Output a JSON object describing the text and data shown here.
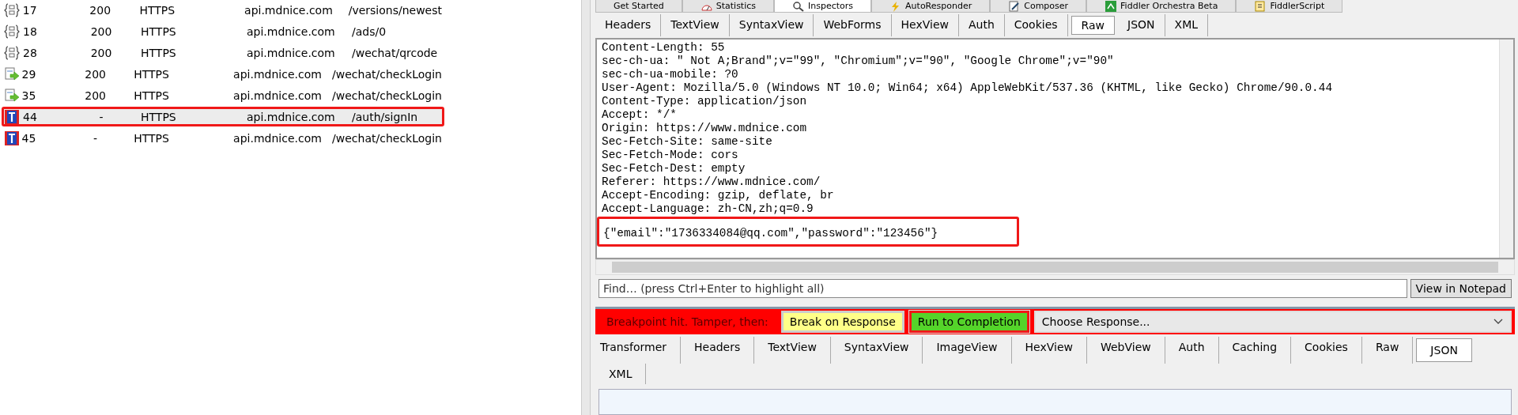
{
  "sessions": [
    {
      "id": "17",
      "result": "200",
      "protocol": "HTTPS",
      "host": "api.mdnice.com",
      "url": "/versions/newest",
      "kind": "json",
      "selected": false,
      "highlighted": false
    },
    {
      "id": "18",
      "result": "200",
      "protocol": "HTTPS",
      "host": "api.mdnice.com",
      "url": "/ads/0",
      "kind": "json",
      "selected": false,
      "highlighted": false
    },
    {
      "id": "28",
      "result": "200",
      "protocol": "HTTPS",
      "host": "api.mdnice.com",
      "url": "/wechat/qrcode",
      "kind": "json",
      "selected": false,
      "highlighted": false
    },
    {
      "id": "29",
      "result": "200",
      "protocol": "HTTPS",
      "host": "api.mdnice.com",
      "url": "/wechat/checkLogin",
      "kind": "response",
      "selected": false,
      "highlighted": false
    },
    {
      "id": "35",
      "result": "200",
      "protocol": "HTTPS",
      "host": "api.mdnice.com",
      "url": "/wechat/checkLogin",
      "kind": "response",
      "selected": false,
      "highlighted": false
    },
    {
      "id": "44",
      "result": "-",
      "protocol": "HTTPS",
      "host": "api.mdnice.com",
      "url": "/auth/signIn",
      "kind": "breakpoint",
      "selected": true,
      "highlighted": true
    },
    {
      "id": "45",
      "result": "-",
      "protocol": "HTTPS",
      "host": "api.mdnice.com",
      "url": "/wechat/checkLogin",
      "kind": "breakpoint",
      "selected": false,
      "highlighted": false
    }
  ],
  "top_tabs": [
    {
      "label": "Get Started",
      "selected": false
    },
    {
      "label": "Statistics",
      "selected": false
    },
    {
      "label": "Inspectors",
      "selected": true
    },
    {
      "label": "AutoResponder",
      "selected": false
    },
    {
      "label": "Composer",
      "selected": false
    },
    {
      "label": "Fiddler Orchestra Beta",
      "selected": false
    },
    {
      "label": "FiddlerScript",
      "selected": false
    }
  ],
  "request_tabs": [
    {
      "label": "Headers",
      "selected": false
    },
    {
      "label": "TextView",
      "selected": false
    },
    {
      "label": "SyntaxView",
      "selected": false
    },
    {
      "label": "WebForms",
      "selected": false
    },
    {
      "label": "HexView",
      "selected": false
    },
    {
      "label": "Auth",
      "selected": false
    },
    {
      "label": "Cookies",
      "selected": false
    },
    {
      "label": "Raw",
      "selected": true
    },
    {
      "label": "JSON",
      "selected": false
    },
    {
      "label": "XML",
      "selected": false
    }
  ],
  "request_raw": {
    "lines": [
      "Content-Length: 55",
      "sec-ch-ua: \" Not A;Brand\";v=\"99\", \"Chromium\";v=\"90\", \"Google Chrome\";v=\"90\"",
      "sec-ch-ua-mobile: ?0",
      "User-Agent: Mozilla/5.0 (Windows NT 10.0; Win64; x64) AppleWebKit/537.36 (KHTML, like Gecko) Chrome/90.0.44",
      "Content-Type: application/json",
      "Accept: */*",
      "Origin: https://www.mdnice.com",
      "Sec-Fetch-Site: same-site",
      "Sec-Fetch-Mode: cors",
      "Sec-Fetch-Dest: empty",
      "Referer: https://www.mdnice.com/",
      "Accept-Encoding: gzip, deflate, br",
      "Accept-Language: zh-CN,zh;q=0.9"
    ],
    "body": "{\"email\":\"1736334084@qq.com\",\"password\":\"123456\"}",
    "body_highlighted": true
  },
  "find": {
    "placeholder": "Find… (press Ctrl+Enter to highlight all)",
    "button": "View in Notepad"
  },
  "breakpoint_bar": {
    "message": "Breakpoint hit. Tamper, then:",
    "break_on_response": "Break on Response",
    "run_to_completion": "Run to Completion",
    "choose_response": "Choose Response...",
    "highlighted": true
  },
  "response_tabs": [
    {
      "label": "Transformer",
      "selected": false
    },
    {
      "label": "Headers",
      "selected": false
    },
    {
      "label": "TextView",
      "selected": false
    },
    {
      "label": "SyntaxView",
      "selected": false
    },
    {
      "label": "ImageView",
      "selected": false
    },
    {
      "label": "HexView",
      "selected": false
    },
    {
      "label": "WebView",
      "selected": false
    },
    {
      "label": "Auth",
      "selected": false
    },
    {
      "label": "Caching",
      "selected": false
    },
    {
      "label": "Cookies",
      "selected": false
    },
    {
      "label": "Raw",
      "selected": false
    },
    {
      "label": "JSON",
      "selected": true
    },
    {
      "label": "XML",
      "selected": false
    }
  ]
}
